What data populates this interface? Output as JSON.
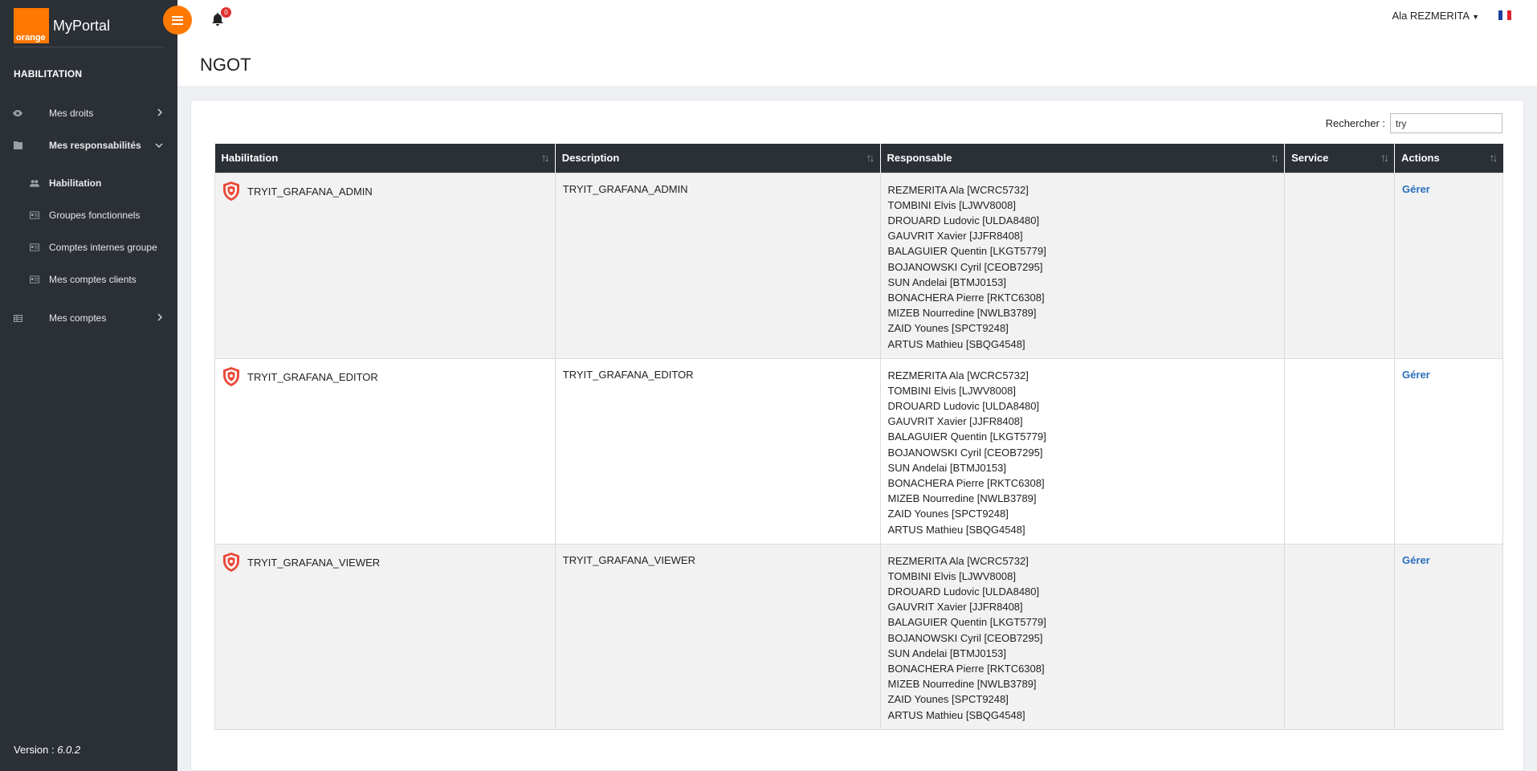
{
  "sidebar": {
    "brand_logo_text": "orange",
    "brand_name": "MyPortal",
    "section_title": "HABILITATION",
    "items": [
      {
        "label": "Mes droits"
      },
      {
        "label": "Mes responsabilités"
      },
      {
        "label": "Habilitation"
      },
      {
        "label": "Groupes fonctionnels"
      },
      {
        "label": "Comptes internes groupe"
      },
      {
        "label": "Mes comptes clients"
      },
      {
        "label": "Mes comptes"
      }
    ],
    "version_label": "Version :",
    "version_value": "6.0.2"
  },
  "topbar": {
    "notification_count": "0",
    "user_name": "Ala REZMERITA",
    "flag_colors": [
      "#1d3fa0",
      "#ffffff",
      "#e0242f"
    ]
  },
  "page": {
    "title": "NGOT"
  },
  "search": {
    "label": "Rechercher :",
    "value": "try"
  },
  "table": {
    "headers": [
      "Habilitation",
      "Description",
      "Responsable",
      "Service",
      "Actions"
    ],
    "rows": [
      {
        "habilitation": "TRYIT_GRAFANA_ADMIN",
        "description": "TRYIT_GRAFANA_ADMIN",
        "responsables": [
          "REZMERITA Ala [WCRC5732]",
          "TOMBINI Elvis [LJWV8008]",
          "DROUARD Ludovic [ULDA8480]",
          "GAUVRIT Xavier [JJFR8408]",
          "BALAGUIER Quentin [LKGT5779]",
          "BOJANOWSKI Cyril [CEOB7295]",
          "SUN Andelai [BTMJ0153]",
          "BONACHERA Pierre [RKTC6308]",
          "MIZEB Nourredine [NWLB3789]",
          "ZAID Younes [SPCT9248]",
          "ARTUS Mathieu [SBQG4548]"
        ],
        "service": "",
        "action": "Gérer"
      },
      {
        "habilitation": "TRYIT_GRAFANA_EDITOR",
        "description": "TRYIT_GRAFANA_EDITOR",
        "responsables": [
          "REZMERITA Ala [WCRC5732]",
          "TOMBINI Elvis [LJWV8008]",
          "DROUARD Ludovic [ULDA8480]",
          "GAUVRIT Xavier [JJFR8408]",
          "BALAGUIER Quentin [LKGT5779]",
          "BOJANOWSKI Cyril [CEOB7295]",
          "SUN Andelai [BTMJ0153]",
          "BONACHERA Pierre [RKTC6308]",
          "MIZEB Nourredine [NWLB3789]",
          "ZAID Younes [SPCT9248]",
          "ARTUS Mathieu [SBQG4548]"
        ],
        "service": "",
        "action": "Gérer"
      },
      {
        "habilitation": "TRYIT_GRAFANA_VIEWER",
        "description": "TRYIT_GRAFANA_VIEWER",
        "responsables": [
          "REZMERITA Ala [WCRC5732]",
          "TOMBINI Elvis [LJWV8008]",
          "DROUARD Ludovic [ULDA8480]",
          "GAUVRIT Xavier [JJFR8408]",
          "BALAGUIER Quentin [LKGT5779]",
          "BOJANOWSKI Cyril [CEOB7295]",
          "SUN Andelai [BTMJ0153]",
          "BONACHERA Pierre [RKTC6308]",
          "MIZEB Nourredine [NWLB3789]",
          "ZAID Younes [SPCT9248]",
          "ARTUS Mathieu [SBQG4548]"
        ],
        "service": "",
        "action": "Gérer"
      }
    ]
  },
  "colors": {
    "accent": "#ff7900",
    "sidebar_bg": "#2b2f36",
    "link": "#2a6ebf",
    "badge": "#e03131",
    "shield": "#e94b3c"
  },
  "icons": {
    "mes_droits": "eye-icon",
    "mes_responsabilites": "folder-icon",
    "habilitation": "users-icon",
    "groupes_fonctionnels": "id-card-icon",
    "comptes_internes": "id-card-icon",
    "comptes_clients": "id-card-icon",
    "mes_comptes": "table-icon",
    "row": "shield-icon"
  }
}
